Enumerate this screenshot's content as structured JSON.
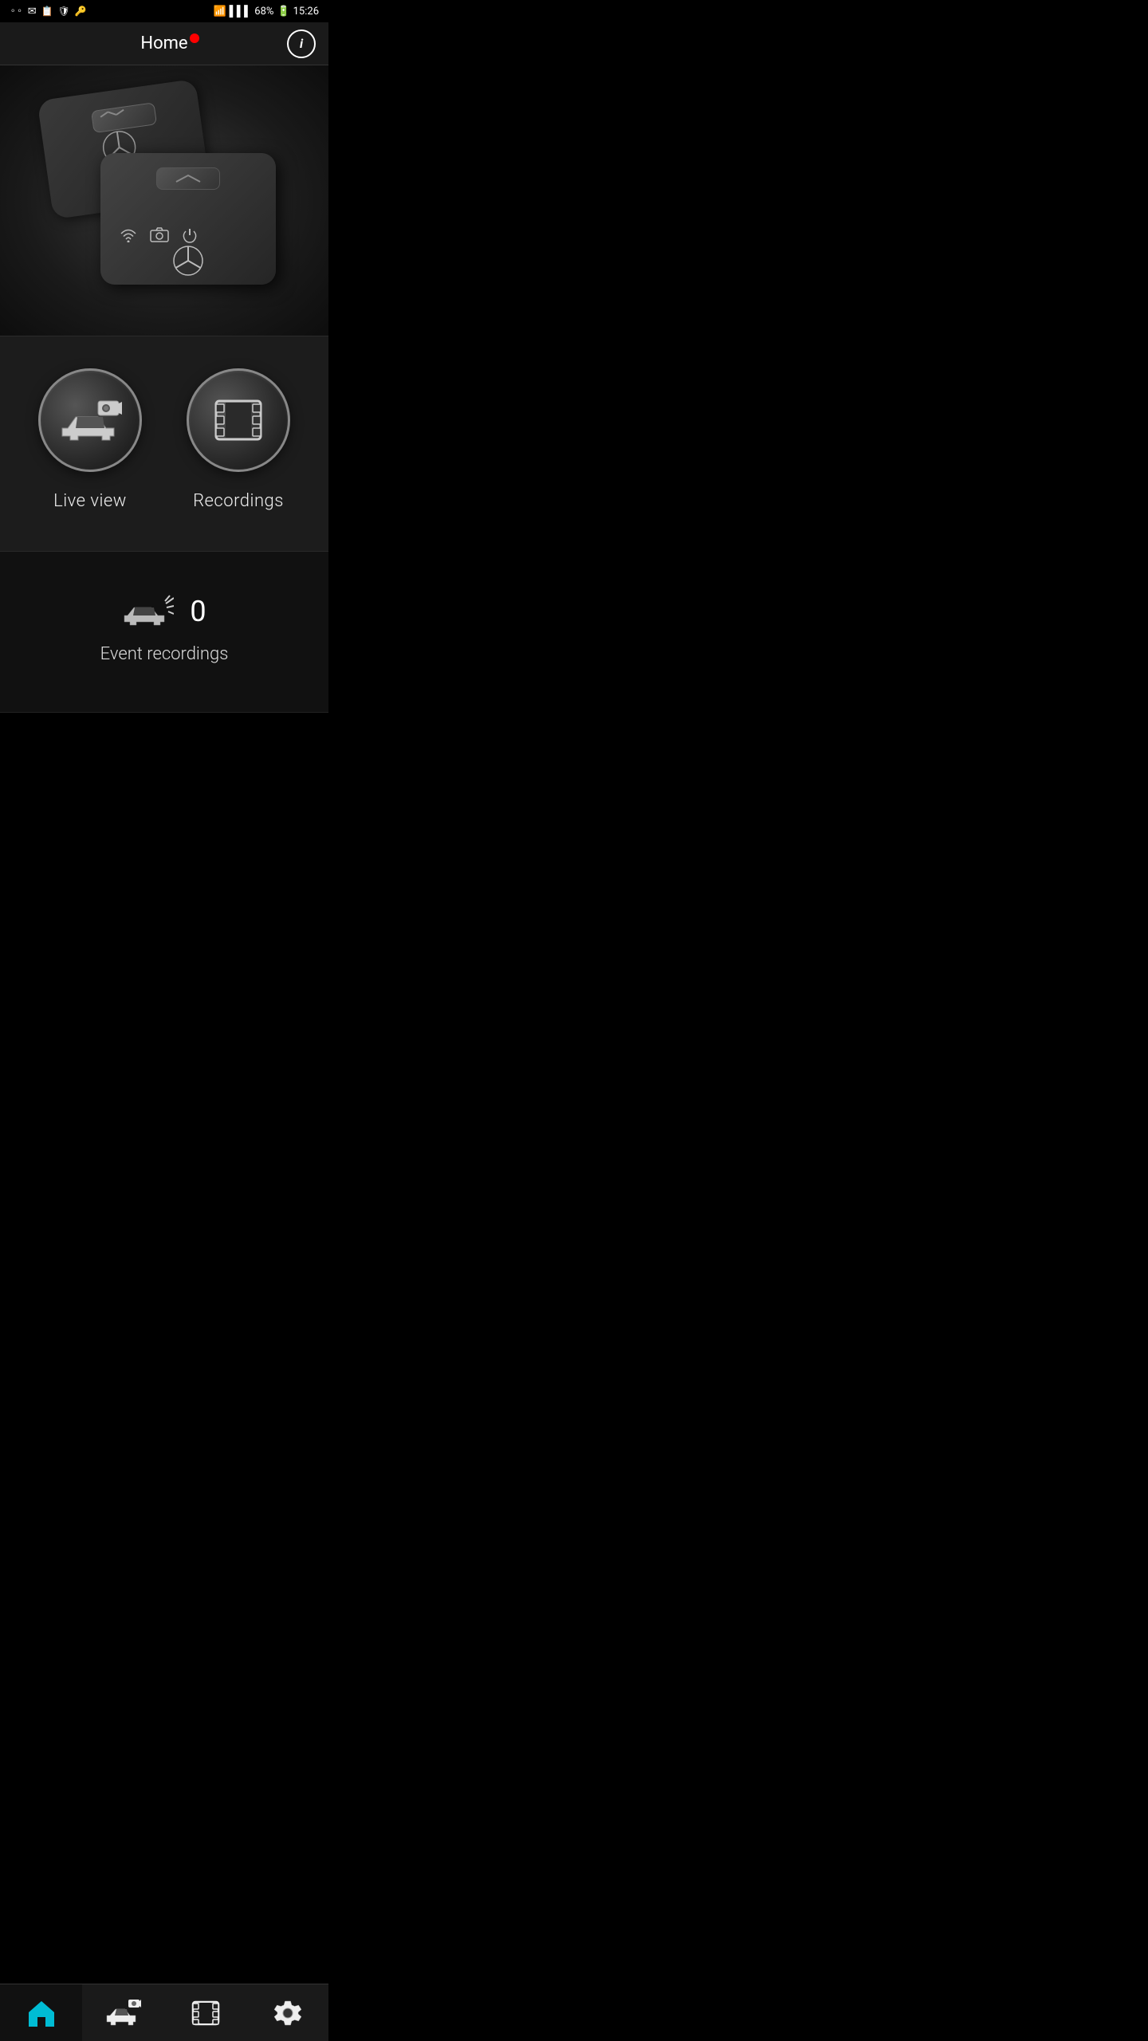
{
  "statusBar": {
    "battery": "68%",
    "time": "15:26",
    "icons": [
      "dots",
      "mail",
      "clipboard",
      "shield",
      "key"
    ]
  },
  "header": {
    "title": "Home",
    "infoButton": "i"
  },
  "mainButtons": {
    "liveView": {
      "label": "Live view"
    },
    "recordings": {
      "label": "Recordings"
    }
  },
  "eventSection": {
    "count": "0",
    "label": "Event recordings"
  },
  "bottomNav": {
    "items": [
      {
        "label": "Home",
        "name": "home"
      },
      {
        "label": "Live",
        "name": "live-view"
      },
      {
        "label": "Recordings",
        "name": "recordings"
      },
      {
        "label": "Settings",
        "name": "settings"
      }
    ]
  }
}
